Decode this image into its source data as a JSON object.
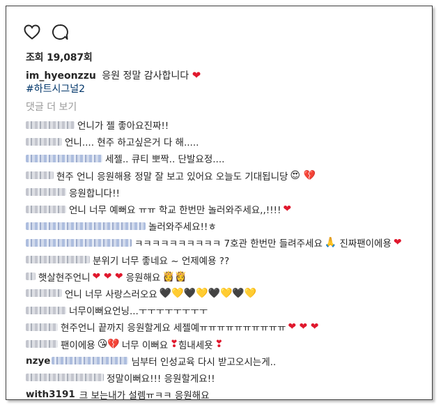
{
  "actions": {
    "like": "heart-outline-icon",
    "comment": "comment-bubble-icon"
  },
  "views": {
    "label": "조회",
    "count": "19,087회"
  },
  "caption": {
    "user": "im_hyeonzzu",
    "text": "응원 정말 감사합니다",
    "emoji": "❤",
    "hashtag": "#하트시그널2"
  },
  "more_comments": "댓글 더 보기",
  "comments": [
    {
      "text": "언니가 젤 좋아요진짜!!"
    },
    {
      "text": "언니.... 현주 하고싶은거 다 해....."
    },
    {
      "text": "세젤.. 큐티 뽀짝.. 단발요정...."
    },
    {
      "text": "현주 언니 응원해용 정말 잘 보고 있어요 오늘도 기대됩니당",
      "emoji": "😍 💔"
    },
    {
      "text": "응원합니다!!"
    },
    {
      "text": "언니 너무 예뻐요 ㅠㅠ 학교 한번만 놀러와주세요,,!!!!",
      "emoji": "❤"
    },
    {
      "text": "놀러와주세요!!ㅎ"
    },
    {
      "text": "ㅋㅋㅋㅋㅋㅋㅋㅋㅋㅋ 7호관 한번만 들려주세요",
      "emoji": "🙏",
      "text2": "진짜팬이에용",
      "emoji2": "❤"
    },
    {
      "text": "분위기 너무 좋네요 ~ 언제예용 ??"
    },
    {
      "text": "햇살현주언니",
      "emoji": "❤ ❤ ❤",
      "text2": "응원해요",
      "emoji2": "👸👸"
    },
    {
      "text": "언니 너무 사랑스러오요",
      "emoji": "🖤💛🖤💛🖤💛🖤💛"
    },
    {
      "text": "너무이뻐요언닝...ㅜㅜㅜㅜㅜㅜㅜㅜ"
    },
    {
      "text": "현주언니 끝까지 응원할게요 세젤예ㅠㅠㅠㅠㅠㅠㅠㅠㅠㅠ",
      "emoji": "❤ ❤ ❤"
    },
    {
      "text": "팬이에용",
      "emoji": "😘💔",
      "text2": "너무 이뻐요",
      "emoji2": "❣",
      "text3": "힘내세욧",
      "emoji3": "❣"
    },
    {
      "user": "nzye",
      "text": "님부터 인성교육 다시 받고오시는게.."
    },
    {
      "text": "정말이뻐요!!! 응원할게요!!"
    },
    {
      "user": "with3191",
      "text": "크 보는내가 설렘ㅠㅋㅋ 응원해요"
    }
  ]
}
